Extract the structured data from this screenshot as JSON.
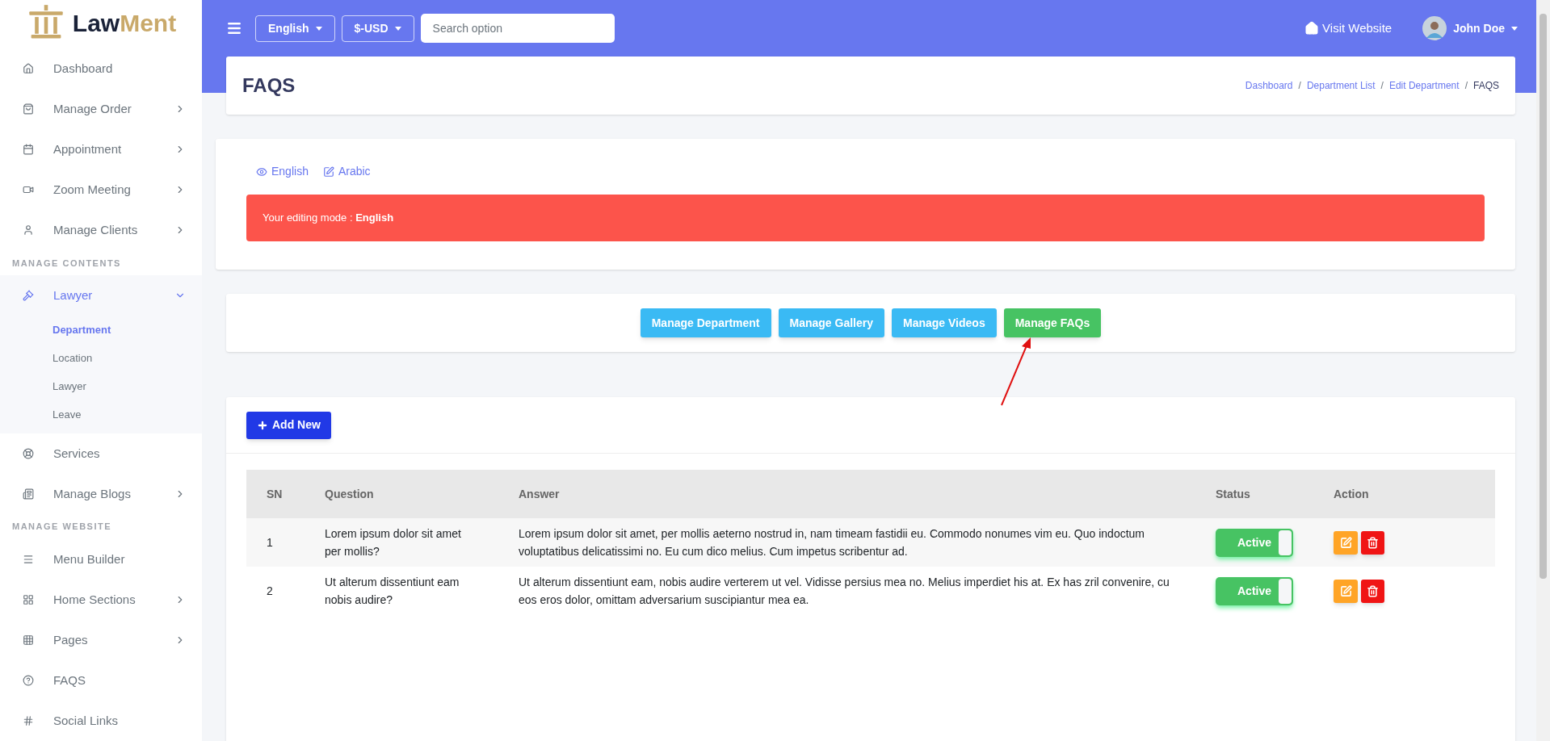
{
  "brand": {
    "part1": "Law",
    "part2": "Ment"
  },
  "sidebar": {
    "items": [
      {
        "kind": "item",
        "label": "Dashboard",
        "has_submenu": false,
        "selected": false
      },
      {
        "kind": "item",
        "label": "Manage Order",
        "has_submenu": true,
        "selected": false
      },
      {
        "kind": "item",
        "label": "Appointment",
        "has_submenu": true,
        "selected": false
      },
      {
        "kind": "item",
        "label": "Zoom Meeting",
        "has_submenu": true,
        "selected": false
      },
      {
        "kind": "item",
        "label": "Manage Clients",
        "has_submenu": true,
        "selected": false
      },
      {
        "kind": "heading",
        "label": "MANAGE CONTENTS"
      },
      {
        "kind": "item",
        "label": "Lawyer",
        "has_submenu": true,
        "selected": true,
        "expanded": true,
        "children": [
          {
            "label": "Department",
            "selected": true
          },
          {
            "label": "Location",
            "selected": false
          },
          {
            "label": "Lawyer",
            "selected": false
          },
          {
            "label": "Leave",
            "selected": false
          }
        ]
      },
      {
        "kind": "item",
        "label": "Services",
        "has_submenu": false,
        "selected": false
      },
      {
        "kind": "item",
        "label": "Manage Blogs",
        "has_submenu": true,
        "selected": false
      },
      {
        "kind": "heading",
        "label": "MANAGE WEBSITE"
      },
      {
        "kind": "item",
        "label": "Menu Builder",
        "has_submenu": false,
        "selected": false
      },
      {
        "kind": "item",
        "label": "Home Sections",
        "has_submenu": true,
        "selected": false
      },
      {
        "kind": "item",
        "label": "Pages",
        "has_submenu": true,
        "selected": false
      },
      {
        "kind": "item",
        "label": "FAQS",
        "has_submenu": false,
        "selected": false
      },
      {
        "kind": "item",
        "label": "Social Links",
        "has_submenu": false,
        "selected": false
      }
    ]
  },
  "topbar": {
    "language": "English",
    "currency": "$-USD",
    "search": {
      "placeholder": "Search option"
    },
    "visit_website": "Visit Website",
    "user": "John Doe"
  },
  "page_header": {
    "title": "FAQS",
    "breadcrumb_separator": "/",
    "breadcrumb": [
      "Dashboard",
      "Department List",
      "Edit Department",
      "FAQS"
    ]
  },
  "language_tabs": [
    "English",
    "Arabic"
  ],
  "alert": {
    "text": "Your editing mode : **English**"
  },
  "section_buttons": [
    {
      "label": "Manage Department",
      "selected": false
    },
    {
      "label": "Manage Gallery",
      "selected": false
    },
    {
      "label": "Manage Videos",
      "selected": false
    },
    {
      "label": "Manage FAQs",
      "selected": true
    }
  ],
  "add_button": "Add New",
  "table": {
    "columns": [
      "SN",
      "Question",
      "Answer",
      "Status",
      "Action"
    ],
    "rows": [
      {
        "sn": "1",
        "question": "Lorem ipsum dolor sit amet per mollis?",
        "answer": "Lorem ipsum dolor sit amet, per mollis aeterno nostrud in, nam timeam fastidii eu. Commodo nonumes vim eu. Quo indoctum voluptatibus delicatissimi no. Eu cum dico melius. Cum impetus scribentur ad.",
        "status": "Active",
        "on": true
      },
      {
        "sn": "2",
        "question": "Ut alterum dissentiunt eam nobis audire?",
        "answer": "Ut alterum dissentiunt eam, nobis audire verterem ut vel. Vidisse persius mea no. Melius imperdiet his at. Ex has zril convenire, cu eos eros dolor, omittam adversarium suscipiantur mea ea.",
        "status": "Active",
        "on": true
      }
    ]
  }
}
